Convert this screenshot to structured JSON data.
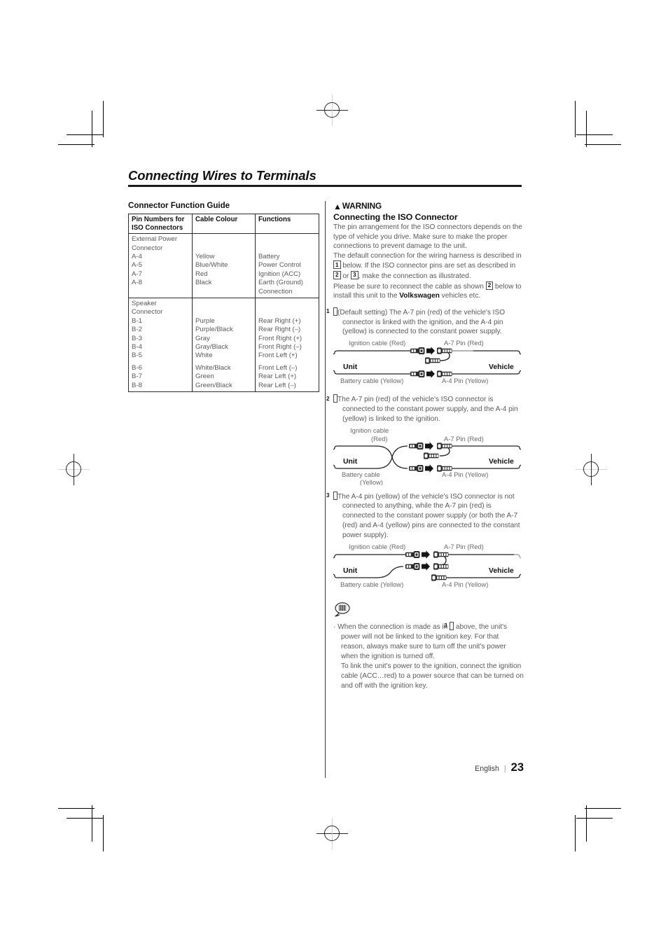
{
  "section": {
    "title": "Connecting Wires to Terminals"
  },
  "left": {
    "heading": "Connector Function Guide",
    "table": {
      "headers": [
        "Pin Numbers for ISO Connectors",
        "Cable Colour",
        "Functions"
      ],
      "groups": [
        {
          "group_label": [
            "External Power",
            "Connector"
          ],
          "pins": [
            "A-4",
            "A-5",
            "A-7",
            "A-8"
          ],
          "colours": [
            "Yellow",
            "Blue/White",
            "Red",
            "Black"
          ],
          "functions": [
            "Battery",
            "Power Control",
            "Ignition (ACC)",
            "Earth (Ground) Connection"
          ]
        },
        {
          "group_label": [
            "Speaker",
            "Connector"
          ],
          "pins": [
            "B-1",
            "B-2",
            "B-3",
            "B-4",
            "B-5",
            "B-6",
            "B-7",
            "B-8"
          ],
          "colours": [
            "Purple",
            "Purple/Black",
            "Gray",
            "Gray/Black",
            "White",
            "White/Black",
            "Green",
            "Green/Black"
          ],
          "functions": [
            "Rear Right (+)",
            "Rear Right (–)",
            "Front Right (+)",
            "Front Right (–)",
            "Front Left (+)",
            "Front Left (–)",
            "Rear Left (+)",
            "Rear Left (–)"
          ]
        }
      ]
    }
  },
  "right": {
    "warning_label": "WARNING",
    "warning_icon": "warning-triangle-icon",
    "sub_heading": "Connecting the ISO Connector",
    "intro_parts": [
      "The pin arrangement for the ISO connectors depends on the type of vehicle you drive. Make sure to make the proper connections to prevent damage to the unit.",
      "The default connection for the wiring harness is described in ",
      "1",
      " below. If the ISO connector pins are set as described in ",
      "2",
      " or ",
      "3",
      ", make the connection as illustrated.",
      "Please be sure to reconnect the cable as shown ",
      "2",
      " below to install this unit to the ",
      "Volkswagen",
      " vehicles etc."
    ],
    "steps": [
      {
        "num": "1",
        "text": "(Default setting) The A-7 pin (red) of the vehicle's ISO connector is linked with the ignition, and the A-4 pin (yellow) is connected to the constant power supply.",
        "diagram": {
          "top_left_label": "Ignition cable (Red)",
          "top_right_label": "A-7 Pin (Red)",
          "bottom_left_label": "Battery cable (Yellow)",
          "bottom_right_label": "A-4 Pin (Yellow)",
          "unit_label": "Unit",
          "vehicle_label": "Vehicle",
          "variant": "straight"
        }
      },
      {
        "num": "2",
        "text": "The A-7 pin (red) of the vehicle's ISO connector is connected to the constant power supply, and the A-4 pin (yellow) is linked to the ignition.",
        "diagram": {
          "top_left_label": "Ignition cable",
          "top_left_label2": "(Red)",
          "top_right_label": "A-7 Pin (Red)",
          "bottom_left_label": "Battery cable",
          "bottom_left_label2": "(Yellow)",
          "bottom_right_label": "A-4 Pin (Yellow)",
          "unit_label": "Unit",
          "vehicle_label": "Vehicle",
          "variant": "crossed"
        }
      },
      {
        "num": "3",
        "text": "The A-4 pin (yellow) of the vehicle's ISO connector is not connected to anything, while the A-7 pin (red) is connected to the constant power supply (or both the A-7 (red) and A-4 (yellow) pins are connected to the constant power supply).",
        "diagram": {
          "top_left_label": "Ignition cable (Red)",
          "top_right_label": "A-7 Pin (Red)",
          "bottom_left_label": "Battery cable (Yellow)",
          "bottom_right_label": "A-4 Pin (Yellow)",
          "unit_label": "Unit",
          "vehicle_label": "Vehicle",
          "variant": "merged"
        }
      }
    ],
    "note": {
      "icon": "note-speech-bubble-icon",
      "bullet": "·",
      "line1_a": "When the connection is made as in ",
      "line1_num": "3",
      "line1_b": " above, the unit's power will not be linked to the ignition key. For that reason, always make sure to turn off the unit's power when the ignition is turned off.",
      "line2": "To link the unit's power to the ignition, connect the ignition cable (ACC…red) to a power source that can be turned on and off with the ignition key."
    }
  },
  "footer": {
    "language": "English",
    "separator": "|",
    "page_number": "23"
  },
  "colors": {
    "text": "#595959",
    "heading": "#111111",
    "rule": "#1a1a1a",
    "table_border": "#2b2b2b"
  }
}
